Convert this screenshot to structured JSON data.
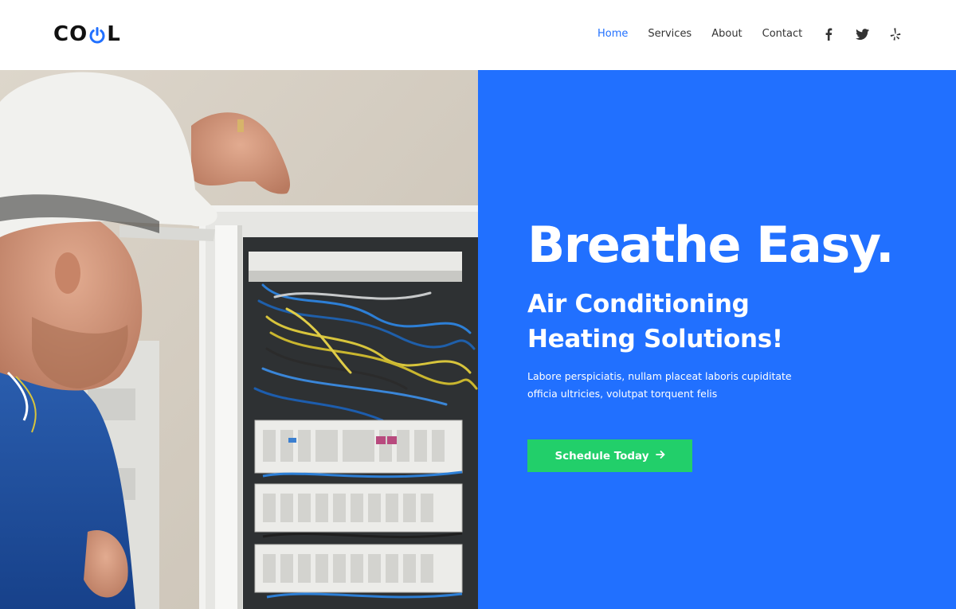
{
  "header": {
    "logo": {
      "text_left": "CO",
      "text_right": "L",
      "power_icon": "power-icon",
      "accent": "#2170ff"
    },
    "nav": [
      {
        "label": "Home",
        "active": true
      },
      {
        "label": "Services",
        "active": false
      },
      {
        "label": "About",
        "active": false
      },
      {
        "label": "Contact",
        "active": false
      }
    ],
    "social": [
      {
        "icon": "facebook-icon"
      },
      {
        "icon": "twitter-icon"
      },
      {
        "icon": "yelp-icon"
      }
    ]
  },
  "hero": {
    "headline": "Breathe Easy.",
    "subhead_line1": "Air Conditioning",
    "subhead_line2": "Heating Solutions!",
    "lede_line1": "Labore perspiciatis, nullam placeat laboris cupiditate",
    "lede_line2": "officia ultricies, volutpat torquent felis",
    "cta_label": "Schedule Today",
    "cta_icon": "arrow-right-icon",
    "image": "electrician-at-panel-photo"
  },
  "colors": {
    "brand_blue": "#2170ff",
    "cta_green": "#22cf6a",
    "text_dark": "#333333"
  }
}
